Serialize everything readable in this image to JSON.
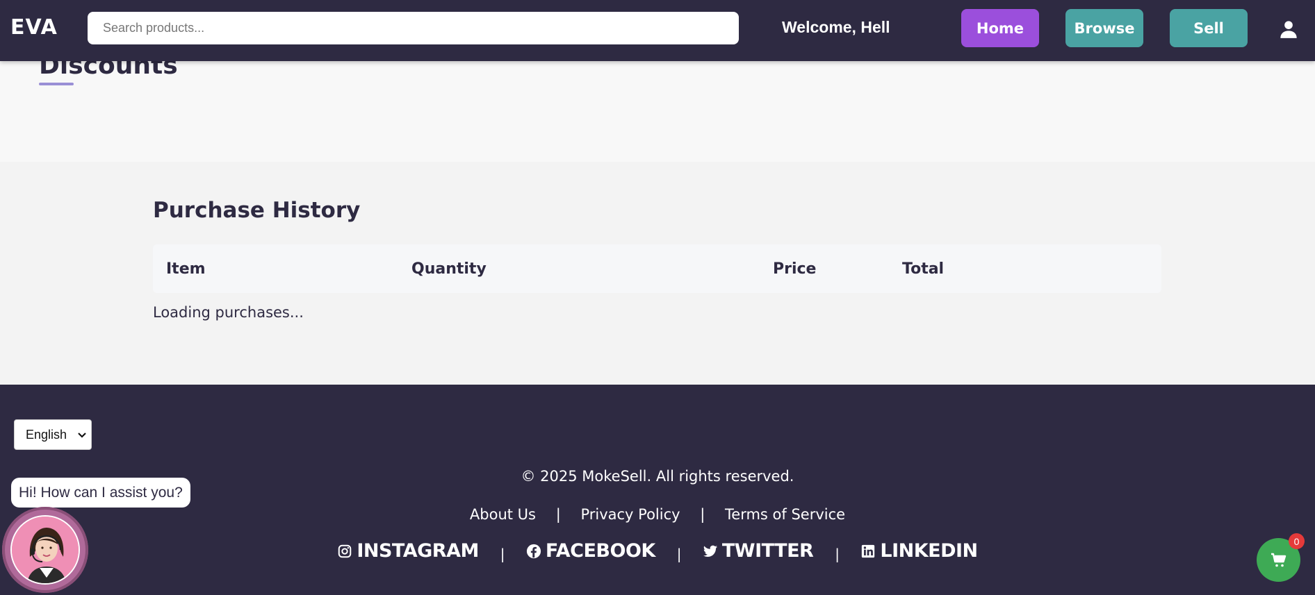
{
  "header": {
    "logo": "EVA",
    "search_placeholder": "Search products...",
    "welcome": "Welcome, Hell",
    "nav": {
      "home": "Home",
      "browse": "Browse",
      "sell": "Sell"
    },
    "colors": {
      "bg": "#2e2a42",
      "home": "#9b4fdc",
      "browse": "#4aa3a3",
      "sell": "#4aa3a3"
    }
  },
  "discounts": {
    "title": "Discounts"
  },
  "purchase_history": {
    "title": "Purchase History",
    "columns": [
      "Item",
      "Quantity",
      "Price",
      "Total"
    ],
    "status": "Loading purchases..."
  },
  "footer": {
    "language": "English",
    "copyright": "© 2025 MokeSell. All rights reserved.",
    "links": [
      "About Us",
      "Privacy Policy",
      "Terms of Service"
    ],
    "separator": "|",
    "social": [
      "INSTAGRAM",
      "FACEBOOK",
      "TWITTER",
      "LINKEDIN"
    ]
  },
  "chat": {
    "greeting": "Hi! How can I assist you?"
  },
  "cart": {
    "count": "0",
    "color": "#3eaa55"
  },
  "icons": [
    "user-icon",
    "instagram-icon",
    "facebook-icon",
    "twitter-icon",
    "linkedin-icon",
    "cart-icon",
    "chevron-down-icon"
  ]
}
